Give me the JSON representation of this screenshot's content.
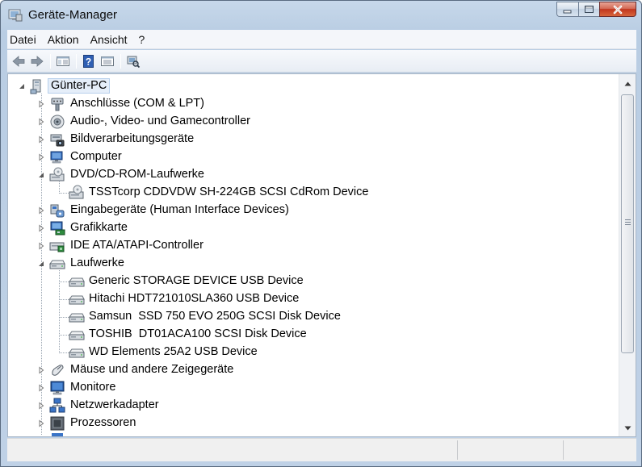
{
  "window": {
    "title": "Geräte-Manager"
  },
  "menu": [
    "Datei",
    "Aktion",
    "Ansicht",
    "?"
  ],
  "toolbar": {
    "buttons": [
      "back-arrow-icon",
      "forward-arrow-icon",
      "show-hide-console-tree-icon",
      "help-icon",
      "properties-icon",
      "scan-hardware-icon"
    ]
  },
  "tree": {
    "root": "Günter-PC",
    "categories": [
      {
        "label": "Anschlüsse (COM & LPT)",
        "expanded": false,
        "icon": "port-icon"
      },
      {
        "label": "Audio-, Video- und Gamecontroller",
        "expanded": false,
        "icon": "audio-icon"
      },
      {
        "label": "Bildverarbeitungsgeräte",
        "expanded": false,
        "icon": "camera-icon"
      },
      {
        "label": "Computer",
        "expanded": false,
        "icon": "computer-icon"
      },
      {
        "label": "DVD/CD-ROM-Laufwerke",
        "expanded": true,
        "icon": "dvd-drive-icon",
        "children": [
          "TSSTcorp CDDVDW SH-224GB SCSI CdRom Device"
        ]
      },
      {
        "label": "Eingabegeräte (Human Interface Devices)",
        "expanded": false,
        "icon": "hid-icon"
      },
      {
        "label": "Grafikkarte",
        "expanded": false,
        "icon": "display-adapter-icon"
      },
      {
        "label": "IDE ATA/ATAPI-Controller",
        "expanded": false,
        "icon": "ide-controller-icon"
      },
      {
        "label": "Laufwerke",
        "expanded": true,
        "icon": "disk-drive-icon",
        "children": [
          "Generic STORAGE DEVICE USB Device",
          "Hitachi HDT721010SLA360 USB Device",
          "Samsun  SSD 750 EVO 250G SCSI Disk Device",
          "TOSHIB  DT01ACA100 SCSI Disk Device",
          "WD Elements 25A2 USB Device"
        ]
      },
      {
        "label": "Mäuse und andere Zeigegeräte",
        "expanded": false,
        "icon": "mouse-icon"
      },
      {
        "label": "Monitore",
        "expanded": false,
        "icon": "monitor-icon"
      },
      {
        "label": "Netzwerkadapter",
        "expanded": false,
        "icon": "network-adapter-icon"
      },
      {
        "label": "Prozessoren",
        "expanded": false,
        "icon": "processor-icon"
      }
    ]
  }
}
